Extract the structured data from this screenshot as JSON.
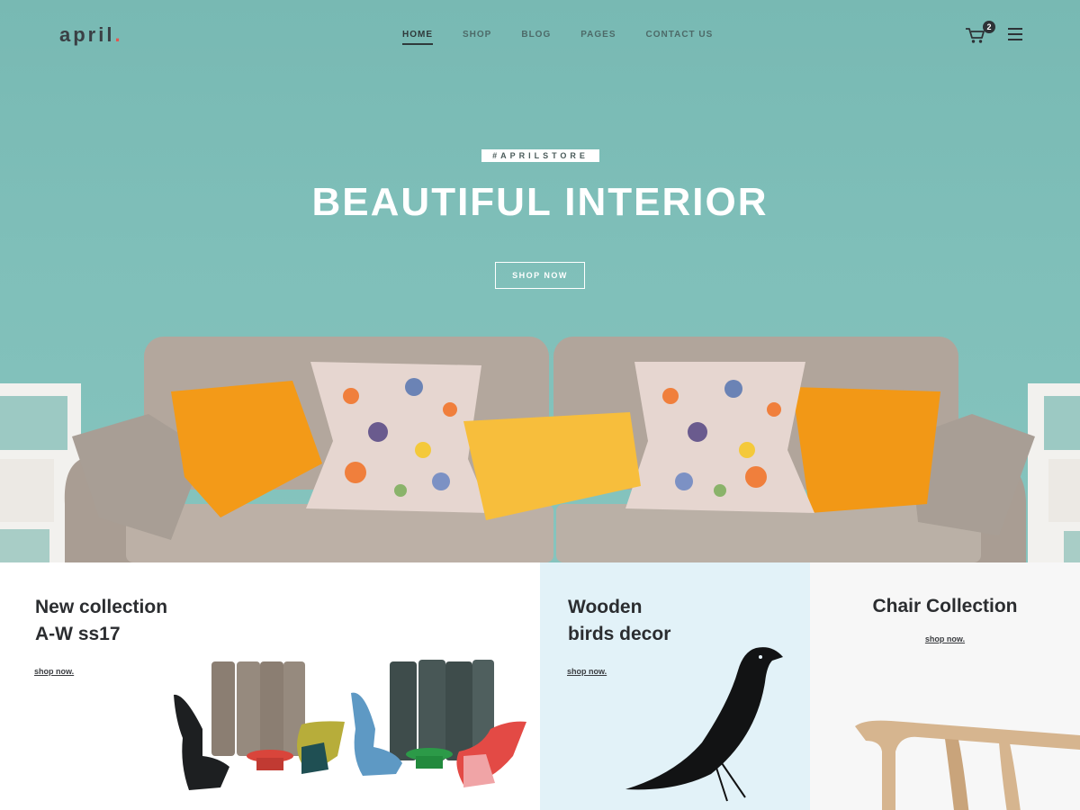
{
  "header": {
    "logo": "april",
    "logo_dot": ".",
    "nav": [
      {
        "label": "HOME",
        "active": true
      },
      {
        "label": "SHOP",
        "active": false
      },
      {
        "label": "BLOG",
        "active": false
      },
      {
        "label": "PAGES",
        "active": false
      },
      {
        "label": "CONTACT US",
        "active": false
      }
    ],
    "cart_count": "2",
    "cart_icon": "cart-icon",
    "menu_icon": "hamburger-menu-icon"
  },
  "hero": {
    "tagline": "#APRILSTORE",
    "title": "BEAUTIFUL INTERIOR",
    "button": "SHOP NOW"
  },
  "collections": [
    {
      "title_line1": "New collection",
      "title_line2": "A-W ss17",
      "link": "shop now."
    },
    {
      "title_line1": "Wooden",
      "title_line2": "birds decor",
      "link": "shop now."
    },
    {
      "title_line1": "Chair Collection",
      "title_line2": "",
      "link": "shop now."
    }
  ],
  "colors": {
    "hero_bg": "#7fbfb9",
    "accent": "#e3564f",
    "text_dark": "#2b2d30",
    "panel_blue": "#e2f2f8",
    "panel_grey": "#f7f7f7"
  }
}
